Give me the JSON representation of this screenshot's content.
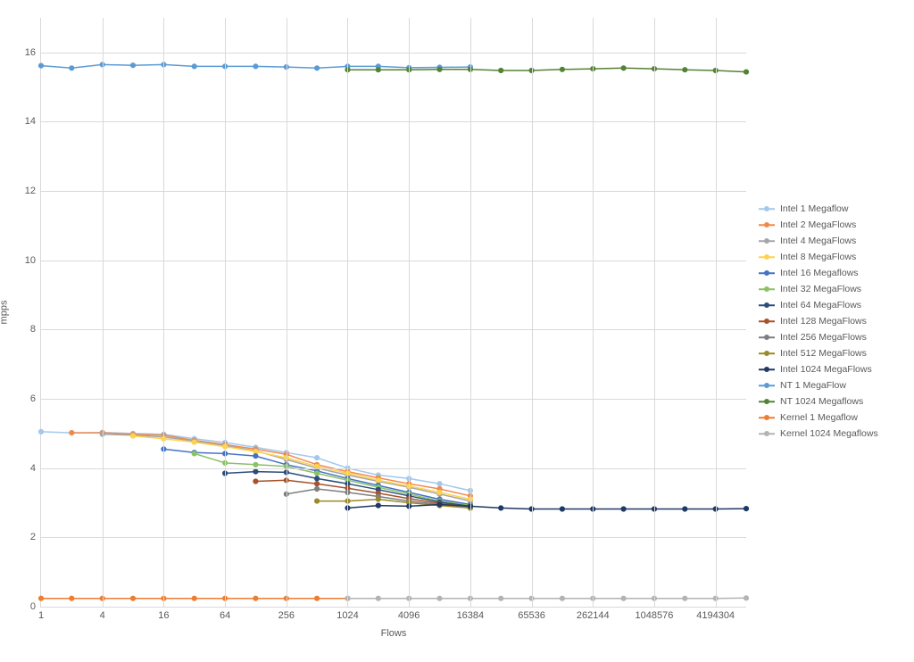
{
  "chart_data": {
    "type": "line",
    "xlabel": "Flows",
    "ylabel": "mpps",
    "x_scale": "log",
    "x_categories_log2": [
      0,
      1,
      2,
      3,
      4,
      5,
      6,
      7,
      8,
      9,
      10,
      11,
      12,
      13,
      14,
      15,
      16,
      17,
      18,
      19,
      20,
      21,
      22,
      23
    ],
    "x_tick_labels": [
      "1",
      "4",
      "16",
      "64",
      "256",
      "1024",
      "4096",
      "16384",
      "65536",
      "262144",
      "1048576",
      "4194304"
    ],
    "x_tick_exponents": [
      0,
      2,
      4,
      6,
      8,
      10,
      12,
      14,
      16,
      18,
      20,
      22
    ],
    "y_ticks": [
      0,
      2,
      4,
      6,
      8,
      10,
      12,
      14,
      16
    ],
    "ylim": [
      0,
      17
    ],
    "xlim_log2": [
      0,
      23
    ],
    "series": [
      {
        "name": "Intel 1 Megaflow",
        "color": "#a3c8ec",
        "start": 0,
        "values": [
          5.05,
          5.02,
          5.03,
          5.0,
          4.98,
          4.85,
          4.74,
          4.6,
          4.45,
          4.3,
          4.0,
          3.8,
          3.7,
          3.55,
          3.35
        ]
      },
      {
        "name": "Intel 2 MegaFlows",
        "color": "#f08a4b",
        "start": 1,
        "values": [
          5.02,
          5.02,
          4.98,
          4.95,
          4.8,
          4.68,
          4.55,
          4.4,
          4.1,
          3.9,
          3.72,
          3.55,
          3.4,
          3.2
        ]
      },
      {
        "name": "Intel 4 MegaFlows",
        "color": "#a6a6a6",
        "start": 2,
        "values": [
          4.98,
          4.95,
          4.9,
          4.78,
          4.65,
          4.5,
          4.25,
          4.0,
          3.8,
          3.62,
          3.45,
          3.25,
          3.05
        ]
      },
      {
        "name": "Intel 8 MegaFlows",
        "color": "#ffd24c",
        "start": 3,
        "values": [
          4.93,
          4.85,
          4.75,
          4.62,
          4.48,
          4.3,
          4.05,
          3.85,
          3.65,
          3.48,
          3.3,
          3.1
        ]
      },
      {
        "name": "Intel 16 Megaflows",
        "color": "#4472c4",
        "start": 4,
        "values": [
          4.55,
          4.45,
          4.42,
          4.35,
          4.1,
          3.92,
          3.7,
          3.5,
          3.3,
          3.1,
          2.95
        ]
      },
      {
        "name": "Intel 32 MegaFlows",
        "color": "#8cc168",
        "start": 5,
        "values": [
          4.42,
          4.15,
          4.1,
          4.05,
          3.85,
          3.65,
          3.45,
          3.25,
          3.05,
          2.92
        ]
      },
      {
        "name": "Intel 64 MegaFlows",
        "color": "#2a4d7a",
        "start": 6,
        "values": [
          3.85,
          3.9,
          3.88,
          3.7,
          3.55,
          3.38,
          3.2,
          3.02,
          2.9
        ]
      },
      {
        "name": "Intel 128 MegaFlows",
        "color": "#a6522a",
        "start": 7,
        "values": [
          3.62,
          3.65,
          3.55,
          3.42,
          3.28,
          3.12,
          2.98,
          2.88
        ]
      },
      {
        "name": "Intel 256 MegaFlows",
        "color": "#7f7f7f",
        "start": 8,
        "values": [
          3.25,
          3.4,
          3.3,
          3.18,
          3.05,
          2.95,
          2.85
        ]
      },
      {
        "name": "Intel 512 MegaFlows",
        "color": "#9a8a2a",
        "start": 9,
        "values": [
          3.05,
          3.05,
          3.1,
          3.0,
          2.92,
          2.85
        ]
      },
      {
        "name": "Intel 1024 MegaFlows",
        "color": "#203864",
        "start": 10,
        "values": [
          2.85,
          2.92,
          2.9,
          2.95,
          2.9,
          2.85,
          2.82,
          2.82,
          2.82,
          2.82,
          2.82,
          2.82,
          2.82,
          2.83
        ]
      },
      {
        "name": "NT 1 MegaFlow",
        "color": "#5b9bd5",
        "start": 0,
        "values": [
          15.62,
          15.55,
          15.65,
          15.63,
          15.65,
          15.6,
          15.6,
          15.6,
          15.58,
          15.55,
          15.6,
          15.6,
          15.56,
          15.57,
          15.58
        ]
      },
      {
        "name": "NT 1024 Megaflows",
        "color": "#548235",
        "start": 10,
        "values": [
          15.5,
          15.5,
          15.5,
          15.51,
          15.51,
          15.48,
          15.48,
          15.51,
          15.53,
          15.55,
          15.53,
          15.5,
          15.48,
          15.44
        ]
      },
      {
        "name": "Kernel 1 Megaflow",
        "color": "#ed7d31",
        "start": 0,
        "values": [
          0.24,
          0.24,
          0.24,
          0.24,
          0.24,
          0.24,
          0.24,
          0.24,
          0.24,
          0.24,
          0.24
        ]
      },
      {
        "name": "Kernel 1024 Megaflows",
        "color": "#b3b3b3",
        "start": 10,
        "values": [
          0.24,
          0.24,
          0.24,
          0.24,
          0.24,
          0.24,
          0.24,
          0.24,
          0.24,
          0.24,
          0.24,
          0.24,
          0.24,
          0.25
        ]
      }
    ]
  }
}
